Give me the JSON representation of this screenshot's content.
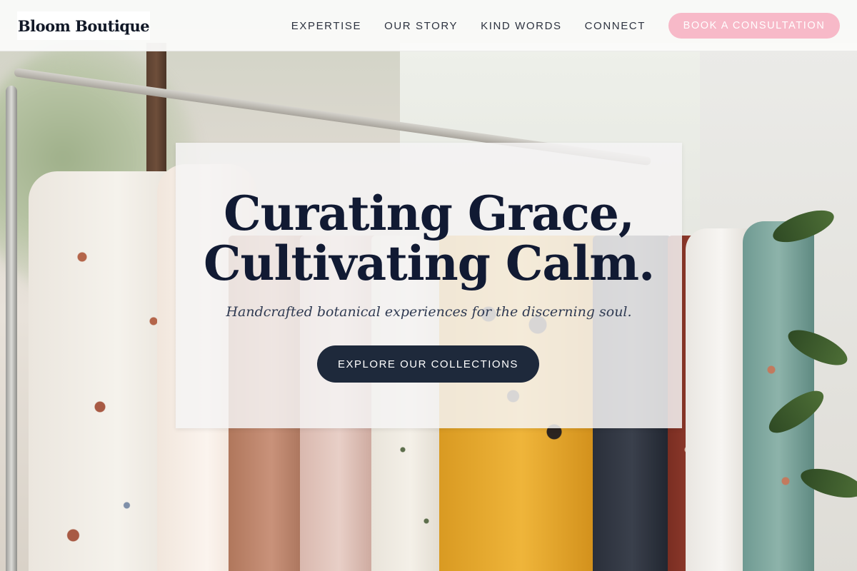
{
  "brand": {
    "logo_text": "Bloom Boutique"
  },
  "nav": {
    "links": [
      {
        "label": "EXPERTISE"
      },
      {
        "label": "OUR STORY"
      },
      {
        "label": "KIND WORDS"
      },
      {
        "label": "CONNECT"
      }
    ],
    "cta_label": "BOOK A CONSULTATION"
  },
  "hero": {
    "headline_line1": "Curating Grace,",
    "headline_line2": "Cultivating Calm.",
    "subtitle": "Handcrafted botanical experiences for the discerning soul.",
    "button_label": "EXPLORE OUR COLLECTIONS",
    "background_image": "clothing-rack-photo"
  },
  "colors": {
    "cta_pink": "#f7b9c8",
    "headline_navy": "#111a33",
    "button_navy": "#1e293b",
    "nav_background": "#fafaf9"
  }
}
